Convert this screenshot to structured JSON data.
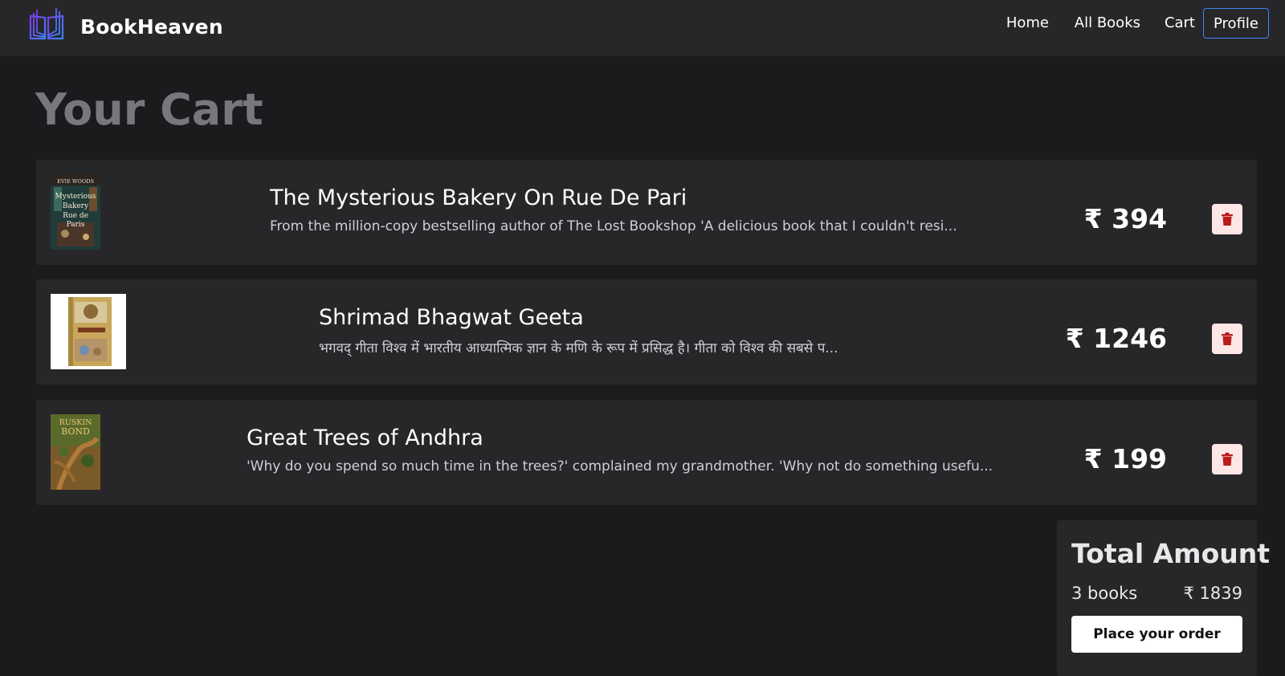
{
  "brand": {
    "name": "BookHeaven",
    "logo_icon": "open-book-icon"
  },
  "nav": {
    "home": "Home",
    "all_books": "All Books",
    "cart": "Cart",
    "profile": "Profile"
  },
  "page": {
    "title": "Your Cart"
  },
  "cart_items": [
    {
      "cover_text": "EVIE WOODS · The Mysterious Bakery on Rue de Paris",
      "title": "The Mysterious Bakery On Rue De Pari",
      "description": "From the million-copy bestselling author of The Lost Bookshop 'A delicious book that I couldn't resi...",
      "price": "₹ 394"
    },
    {
      "cover_text": "Shrimad Bhagwat Geeta",
      "title": "Shrimad Bhagwat Geeta",
      "description": "भगवद् गीता विश्व में भारतीय आध्यात्मिक ज्ञान के मणि के रूप में प्रसिद्ध है। गीता को विश्व की सबसे प...",
      "price": "₹ 1246"
    },
    {
      "cover_text": "RUSKIN BOND",
      "title": "Great Trees of Andhra",
      "description": "'Why do you spend so much time in the trees?' complained my grandmother. 'Why not do something usefu...",
      "price": "₹ 199"
    }
  ],
  "summary": {
    "title": "Total Amount",
    "count": "3 books",
    "total": "₹ 1839",
    "order_button": "Place your order"
  },
  "colors": {
    "background": "#1b1b1e",
    "card": "#27272a",
    "accent": "#3b82f6",
    "delete": "#b91c1c"
  }
}
